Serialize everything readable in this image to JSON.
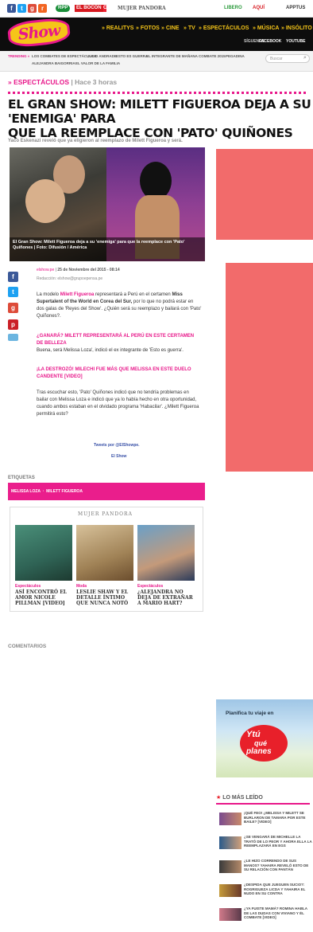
{
  "topbar": {
    "social_icons": [
      "facebook-icon",
      "twitter-icon",
      "google-plus-icon",
      "rss-icon"
    ],
    "partners": [
      "RPP",
      "EL BOCÓN",
      "CORREO",
      "MUJER PANDORA"
    ],
    "right_partners": [
      "LIBERO",
      "AQUÍ",
      "APPTUS"
    ]
  },
  "header": {
    "logo": "Show",
    "nav": [
      "» REALITYS",
      "» FOTOS",
      "» CINE",
      "» TV",
      "» ESPECTÁCULOS",
      "» MÚSICA",
      "» INSÓLITO"
    ],
    "social_labels": [
      "SÍGUENOS",
      "FACEBOOK",
      "YOUTUBE"
    ]
  },
  "trending": {
    "label": "TRENDING »",
    "items": [
      "LOS COMBATES DE ESPECTÁCULOS",
      "JULIO ANDRADE",
      "ESTO ES GUERRA",
      "EL INTEGRANTE DE MAÑANA",
      "COMBATE 2015",
      "PEGADINA",
      "ALEJANDRA BAIGORRIA",
      "EL VALOR DE LA FAMILIA"
    ],
    "search_placeholder": "Buscar"
  },
  "section": {
    "category": "» ESPECTÁCULOS",
    "time": "Hace 3 horas"
  },
  "article": {
    "title_line1": "EL GRAN SHOW: MILETT FIGUEROA DEJA A SU 'ENEMIGA' PARA",
    "title_line2": "QUE LA REEMPLACE CON 'PATO' QUIÑONES",
    "subtitle": "Yaco Eskenazi reveló que ya eligieron al reemplazo de Milett Figueroa y será.",
    "photo_caption": "El Gran Show: Milett Figueroa deja a su 'enemiga' para que la reemplace con 'Pato' Quiñones | Foto: Difusión / América",
    "meta_author": "elshow.pe",
    "meta_date": "25 de Noviembre del 2015 - 08:14",
    "meta_source": "Redacción: elshow@grupoepensa.pe",
    "p1_prefix": "La modelo",
    "p1_name": "Milett Figueroa",
    "p1_rest": "representará a Perú en el certamen",
    "p1_bold": "Miss Supertalent of the World en Corea del Sur,",
    "p1_rest2": "por lo que no podrá estar en dos galas de 'Reyes del Show'. ¿Quién será su reemplazo y bailará con 'Pato' Quiñones?.",
    "link1": "¿GANARÁ? MILETT REPRESENTARÁ AL PERÚ EN ESTE CERTAMEN DE BELLEZA",
    "p2": "Buena, será Melissa Loza', indicó el ex integrante de 'Esto es guerra'.",
    "link2": "¡LA DESTROZÓ! MILECHI FUE MÁS QUE MELISSA EN ESTE DUELO CANDENTE [VIDEO]",
    "p3": "Tras escuchar esto, 'Pato' Quiñones indicó que no tendría problemas en bailar con Melissa Loza e indicó que ya lo había hecho en otra oportunidad, cuando ambos estaban en el olvidado programa 'Habacilar'. ¿Milett Figueroa permitirá esto?",
    "tweets_by": "Tweets por @ElShowpe.",
    "el_show": "El Show"
  },
  "tags": {
    "heading": "ETIQUETAS",
    "items": [
      "MELISSA LOZA",
      "MILETT FIGUEROA"
    ]
  },
  "related": {
    "source": "MUJER PANDORA",
    "items": [
      {
        "label": "Espectáculos",
        "title": "ASÍ ENCONTRÓ EL AMOR NICOLE PILLMAN [VIDEO]"
      },
      {
        "label": "Moda",
        "title": "LESLIE SHAW Y EL DETALLE ÍNTIMO QUE NUNCA NOTÓ"
      },
      {
        "label": "Espectáculos",
        "title": "¿ALEJANDRA NO DEJA DE EXTRAÑAR A MARIO HART?"
      }
    ]
  },
  "comments": {
    "heading": "COMENTARIOS"
  },
  "ad": {
    "line1": "Planifica tu viaje en",
    "brand_a": "Ytú",
    "brand_b": "qué",
    "brand_c": "planes"
  },
  "most_read": {
    "heading": "LO MÁS LEÍDO",
    "items": [
      "¡QUÉ FEO! ¿MELISSA Y MILETT SE BURLARON DE TAMARA POR ESTE BAILE? [VIDEO]",
      "¿SE VENGARÁ DE MICHELLE LA TRATÓ DE LO PEOR Y AHORA ELLA LA REEMPLAZARÁ EN EGS",
      "¿LE HIZO CORRENDO DE SUS MANOS? YAHAIRA REVELÓ ESTO DE SU RELACIÓN CON PANTÁN",
      "¿DESPIDA QUE JUEGUEN SUCIO?: ROGRIGUEZA LICDA Y YAHAIRA EL NUDO EN SU CONTRA",
      "¿YA FUISTE MAMÁ? ROMINA HABLA DE LAS DUDAS CON VIVIANO Y ÉL COMBATE [VIDEO]"
    ]
  }
}
